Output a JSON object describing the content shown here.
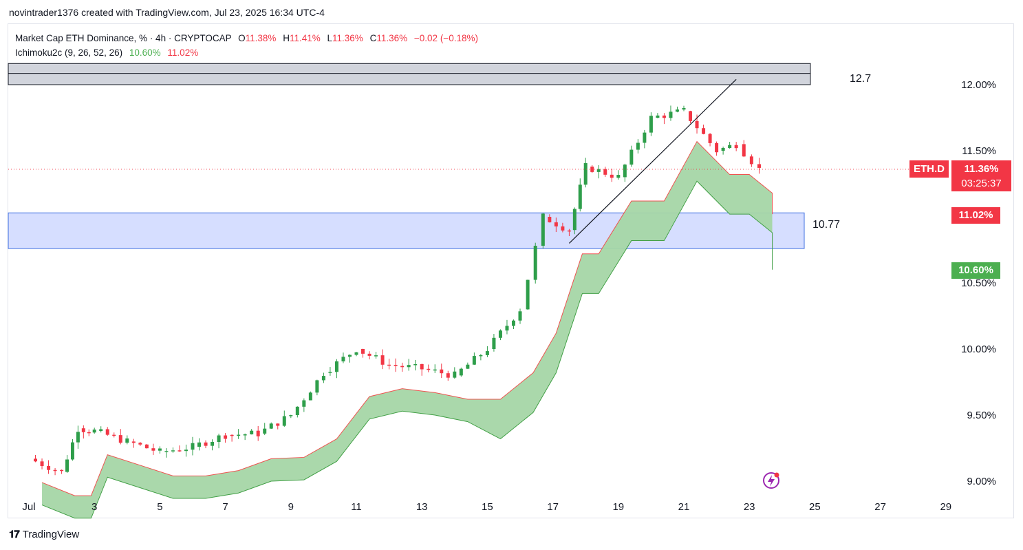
{
  "credit": "novintrader1376 created with TradingView.com, Jul 23, 2025 16:34 UTC-4",
  "legend": {
    "symbol": "Market Cap ETH Dominance, % · 4h · CRYPTOCAP",
    "o_label": "O",
    "o_val": "11.38%",
    "h_label": "H",
    "h_val": "11.41%",
    "l_label": "L",
    "l_val": "11.36%",
    "c_label": "C",
    "c_val": "11.36%",
    "change": "−0.02 (−0.18%)",
    "indicator": "Ichimoku2c (9, 26, 52, 26)",
    "ind_val1": "10.60%",
    "ind_val2": "11.02%"
  },
  "levels": {
    "upper_label": "12.7",
    "lower_label": "10.77"
  },
  "tags": {
    "symbol": "ETH.D",
    "price": "11.36%",
    "countdown": "03:25:37",
    "span_red": "11.02%",
    "span_green": "10.60%"
  },
  "footer": {
    "brand": "TradingView"
  },
  "colors": {
    "up": "#26a69a",
    "down": "#f23645",
    "green_candle": "#2e9e4a",
    "cloud": "#a5d6a7",
    "blue_zone": "#d6deff"
  },
  "chart_data": {
    "type": "candlestick",
    "title": "Market Cap ETH Dominance, % · 4h · CRYPTOCAP",
    "ylim": [
      8.85,
      12.35
    ],
    "y_ticks": [
      "12.00%",
      "11.50%",
      "10.50%",
      "10.00%",
      "9.50%",
      "9.00%"
    ],
    "y_tick_values": [
      12.0,
      11.5,
      10.5,
      10.0,
      9.5,
      9.0
    ],
    "x_ticks": [
      "Jul",
      "3",
      "5",
      "7",
      "9",
      "11",
      "13",
      "15",
      "17",
      "19",
      "21",
      "23",
      "25",
      "27",
      "29"
    ],
    "x_tick_days": [
      1,
      3,
      5,
      7,
      9,
      11,
      13,
      15,
      17,
      19,
      21,
      23,
      25,
      27,
      29
    ],
    "last_price": 11.36,
    "zones": [
      {
        "name": "resistance",
        "y_low": 12.0,
        "y_high": 12.16
      },
      {
        "name": "support",
        "y_low": 10.76,
        "y_high": 11.03
      }
    ],
    "trendline": [
      {
        "day": 17.5,
        "value": 10.8
      },
      {
        "day": 22.6,
        "value": 12.04
      }
    ],
    "candles_daily_close": [
      {
        "day": 1,
        "value": 9.17
      },
      {
        "day": 2,
        "value": 9.07
      },
      {
        "day": 2.5,
        "value": 9.4
      },
      {
        "day": 3,
        "value": 9.38
      },
      {
        "day": 4,
        "value": 9.3
      },
      {
        "day": 5,
        "value": 9.22
      },
      {
        "day": 6,
        "value": 9.26
      },
      {
        "day": 7,
        "value": 9.35
      },
      {
        "day": 8,
        "value": 9.36
      },
      {
        "day": 9,
        "value": 9.5
      },
      {
        "day": 10,
        "value": 9.82
      },
      {
        "day": 11,
        "value": 10.0
      },
      {
        "day": 12,
        "value": 9.88
      },
      {
        "day": 13,
        "value": 9.85
      },
      {
        "day": 14,
        "value": 9.8
      },
      {
        "day": 15,
        "value": 10.0
      },
      {
        "day": 16,
        "value": 10.3
      },
      {
        "day": 16.7,
        "value": 11.0
      },
      {
        "day": 17.5,
        "value": 10.9
      },
      {
        "day": 18,
        "value": 11.38
      },
      {
        "day": 19,
        "value": 11.3
      },
      {
        "day": 20,
        "value": 11.75
      },
      {
        "day": 21,
        "value": 11.8
      },
      {
        "day": 22,
        "value": 11.5
      },
      {
        "day": 22.6,
        "value": 11.55
      },
      {
        "day": 23.3,
        "value": 11.36
      }
    ]
  }
}
